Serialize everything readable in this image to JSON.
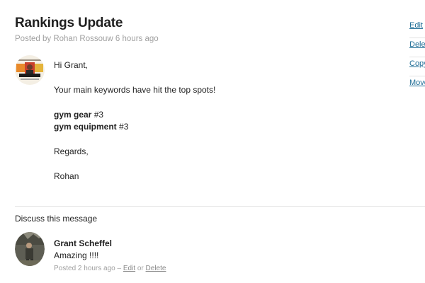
{
  "post": {
    "title": "Rankings Update",
    "byline": "Posted by Rohan Rossouw 6 hours ago"
  },
  "actions": {
    "edit": "Edit",
    "delete": "Dele",
    "copy": "Copy",
    "move": "Move"
  },
  "message": {
    "greeting": "Hi Grant,",
    "intro": "Your main keywords have hit the top spots!",
    "keywords": [
      {
        "term": "gym gear",
        "rank": " #3"
      },
      {
        "term": "gym equipment",
        "rank": " #3"
      }
    ],
    "closing": "Regards,",
    "signature": "Rohan"
  },
  "discussion": {
    "heading": "Discuss this message",
    "comment": {
      "author": "Grant Scheffel",
      "body": "Amazing !!!!",
      "meta_prefix": "Posted 2 hours ago – ",
      "edit_label": "Edit",
      "separator": " or ",
      "delete_label": "Delete"
    }
  },
  "colors": {
    "link": "#1e6d96",
    "muted_text": "#a0a0a0"
  }
}
